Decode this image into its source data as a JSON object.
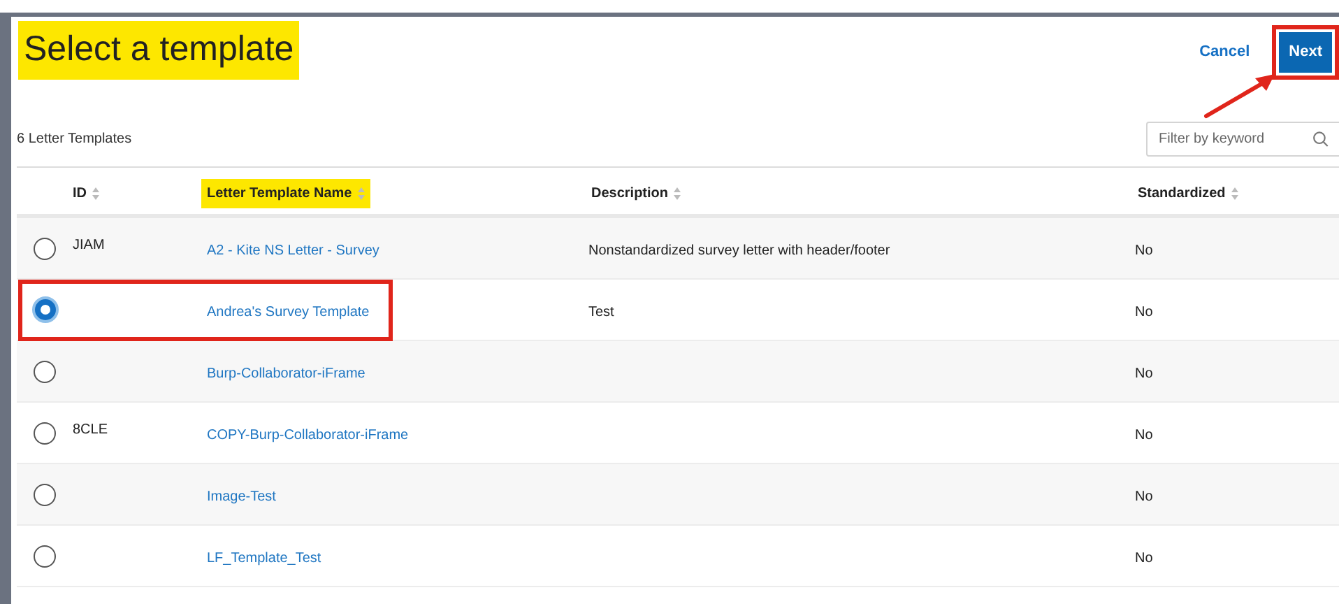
{
  "title": {
    "text": "Select a template",
    "highlighted": true
  },
  "actions": [
    {
      "label": "Cancel",
      "kind": "link",
      "outlined": false
    },
    {
      "label": "Next",
      "kind": "primary",
      "outlined": true
    }
  ],
  "count": "6 Letter Templates",
  "search": {
    "placeholder": "Filter by keyword"
  },
  "table": {
    "columns": [
      {
        "label": "ID",
        "highlighted": false
      },
      {
        "label": "Letter Template Name",
        "highlighted": true
      },
      {
        "label": "Description",
        "highlighted": false
      },
      {
        "label": "Standardized",
        "highlighted": false
      }
    ],
    "rows": [
      {
        "selected": false,
        "outlined": false,
        "id": "JIAM",
        "name": "A2 - Kite NS Letter - Survey",
        "description": "Nonstandardized survey letter with header/footer",
        "standardized": "No"
      },
      {
        "selected": true,
        "outlined": true,
        "id": "",
        "name": "Andrea's Survey Template",
        "description": "Test",
        "standardized": "No"
      },
      {
        "selected": false,
        "outlined": false,
        "id": "",
        "name": "Burp-Collaborator-iFrame",
        "description": "",
        "standardized": "No"
      },
      {
        "selected": false,
        "outlined": false,
        "id": "8CLE",
        "name": "COPY-Burp-Collaborator-iFrame",
        "description": "",
        "standardized": "No"
      },
      {
        "selected": false,
        "outlined": false,
        "id": "",
        "name": "Image-Test",
        "description": "",
        "standardized": "No"
      },
      {
        "selected": false,
        "outlined": false,
        "id": "",
        "name": "LF_Template_Test",
        "description": "",
        "standardized": "No"
      }
    ]
  }
}
